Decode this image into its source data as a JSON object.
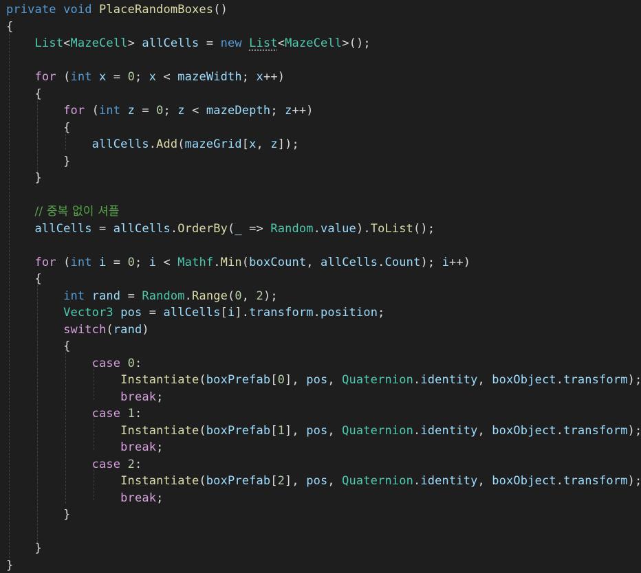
{
  "colors": {
    "background": "#1e1e1e",
    "keyword": "#569cd6",
    "control": "#d8a0df",
    "type": "#4ec9b0",
    "method": "#dcdcaa",
    "variable": "#9cdcfe",
    "plain": "#dcdcdc",
    "number": "#b5cea8",
    "comment": "#57a64a"
  },
  "lines": [
    [
      [
        "kw",
        "private"
      ],
      [
        "p",
        " "
      ],
      [
        "kw",
        "void"
      ],
      [
        "p",
        " "
      ],
      [
        "m",
        "PlaceRandomBoxes"
      ],
      [
        "p",
        "()"
      ]
    ],
    [
      [
        "p",
        "{"
      ]
    ],
    [
      [
        "p",
        "    "
      ],
      [
        "t",
        "List"
      ],
      [
        "p",
        "<"
      ],
      [
        "t",
        "MazeCell"
      ],
      [
        "p",
        "> "
      ],
      [
        "v",
        "allCells"
      ],
      [
        "p",
        " = "
      ],
      [
        "kw",
        "new"
      ],
      [
        "p",
        " "
      ],
      [
        "tsq",
        "List"
      ],
      [
        "p",
        "<"
      ],
      [
        "t",
        "MazeCell"
      ],
      [
        "p",
        ">();"
      ]
    ],
    [],
    [
      [
        "p",
        "    "
      ],
      [
        "c",
        "for"
      ],
      [
        "p",
        " ("
      ],
      [
        "kw",
        "int"
      ],
      [
        "p",
        " "
      ],
      [
        "v",
        "x"
      ],
      [
        "p",
        " = "
      ],
      [
        "n",
        "0"
      ],
      [
        "p",
        "; "
      ],
      [
        "v",
        "x"
      ],
      [
        "p",
        " < "
      ],
      [
        "v",
        "mazeWidth"
      ],
      [
        "p",
        "; "
      ],
      [
        "v",
        "x"
      ],
      [
        "p",
        "++)"
      ]
    ],
    [
      [
        "p",
        "    {"
      ]
    ],
    [
      [
        "p",
        "        "
      ],
      [
        "c",
        "for"
      ],
      [
        "p",
        " ("
      ],
      [
        "kw",
        "int"
      ],
      [
        "p",
        " "
      ],
      [
        "v",
        "z"
      ],
      [
        "p",
        " = "
      ],
      [
        "n",
        "0"
      ],
      [
        "p",
        "; "
      ],
      [
        "v",
        "z"
      ],
      [
        "p",
        " < "
      ],
      [
        "v",
        "mazeDepth"
      ],
      [
        "p",
        "; "
      ],
      [
        "v",
        "z"
      ],
      [
        "p",
        "++)"
      ]
    ],
    [
      [
        "p",
        "        {"
      ]
    ],
    [
      [
        "p",
        "            "
      ],
      [
        "v",
        "allCells"
      ],
      [
        "p",
        "."
      ],
      [
        "m",
        "Add"
      ],
      [
        "p",
        "("
      ],
      [
        "v",
        "mazeGrid"
      ],
      [
        "p",
        "["
      ],
      [
        "v",
        "x"
      ],
      [
        "p",
        ", "
      ],
      [
        "v",
        "z"
      ],
      [
        "p",
        "]);"
      ]
    ],
    [
      [
        "p",
        "        }"
      ]
    ],
    [
      [
        "p",
        "    }"
      ]
    ],
    [],
    [
      [
        "p",
        "    "
      ],
      [
        "cm",
        "// 중복 없이 셔플"
      ]
    ],
    [
      [
        "p",
        "    "
      ],
      [
        "v",
        "allCells"
      ],
      [
        "p",
        " = "
      ],
      [
        "v",
        "allCells"
      ],
      [
        "p",
        "."
      ],
      [
        "m",
        "OrderBy"
      ],
      [
        "p",
        "("
      ],
      [
        "v",
        "_"
      ],
      [
        "p",
        " => "
      ],
      [
        "t",
        "Random"
      ],
      [
        "p",
        "."
      ],
      [
        "v",
        "value"
      ],
      [
        "p",
        ")."
      ],
      [
        "m",
        "ToList"
      ],
      [
        "p",
        "();"
      ]
    ],
    [],
    [
      [
        "p",
        "    "
      ],
      [
        "c",
        "for"
      ],
      [
        "p",
        " ("
      ],
      [
        "kw",
        "int"
      ],
      [
        "p",
        " "
      ],
      [
        "v",
        "i"
      ],
      [
        "p",
        " = "
      ],
      [
        "n",
        "0"
      ],
      [
        "p",
        "; "
      ],
      [
        "v",
        "i"
      ],
      [
        "p",
        " < "
      ],
      [
        "t",
        "Mathf"
      ],
      [
        "p",
        "."
      ],
      [
        "m",
        "Min"
      ],
      [
        "p",
        "("
      ],
      [
        "v",
        "boxCount"
      ],
      [
        "p",
        ", "
      ],
      [
        "v",
        "allCells"
      ],
      [
        "p",
        "."
      ],
      [
        "v",
        "Count"
      ],
      [
        "p",
        "); "
      ],
      [
        "v",
        "i"
      ],
      [
        "p",
        "++)"
      ]
    ],
    [
      [
        "p",
        "    {"
      ]
    ],
    [
      [
        "p",
        "        "
      ],
      [
        "kw",
        "int"
      ],
      [
        "p",
        " "
      ],
      [
        "v",
        "rand"
      ],
      [
        "p",
        " = "
      ],
      [
        "t",
        "Random"
      ],
      [
        "p",
        "."
      ],
      [
        "m",
        "Range"
      ],
      [
        "p",
        "("
      ],
      [
        "n",
        "0"
      ],
      [
        "p",
        ", "
      ],
      [
        "n",
        "2"
      ],
      [
        "p",
        ");"
      ]
    ],
    [
      [
        "p",
        "        "
      ],
      [
        "t",
        "Vector3"
      ],
      [
        "p",
        " "
      ],
      [
        "v",
        "pos"
      ],
      [
        "p",
        " = "
      ],
      [
        "v",
        "allCells"
      ],
      [
        "p",
        "["
      ],
      [
        "v",
        "i"
      ],
      [
        "p",
        "]."
      ],
      [
        "v",
        "transform"
      ],
      [
        "p",
        "."
      ],
      [
        "v",
        "position"
      ],
      [
        "p",
        ";"
      ]
    ],
    [
      [
        "p",
        "        "
      ],
      [
        "c",
        "switch"
      ],
      [
        "p",
        "("
      ],
      [
        "v",
        "rand"
      ],
      [
        "p",
        ")"
      ]
    ],
    [
      [
        "p",
        "        {"
      ]
    ],
    [
      [
        "p",
        "            "
      ],
      [
        "c",
        "case"
      ],
      [
        "p",
        " "
      ],
      [
        "n",
        "0"
      ],
      [
        "p",
        ":"
      ]
    ],
    [
      [
        "p",
        "                "
      ],
      [
        "m",
        "Instantiate"
      ],
      [
        "p",
        "("
      ],
      [
        "v",
        "boxPrefab"
      ],
      [
        "p",
        "["
      ],
      [
        "n",
        "0"
      ],
      [
        "p",
        "], "
      ],
      [
        "v",
        "pos"
      ],
      [
        "p",
        ", "
      ],
      [
        "t",
        "Quaternion"
      ],
      [
        "p",
        "."
      ],
      [
        "v",
        "identity"
      ],
      [
        "p",
        ", "
      ],
      [
        "v",
        "boxObject"
      ],
      [
        "p",
        "."
      ],
      [
        "v",
        "transform"
      ],
      [
        "p",
        ");"
      ]
    ],
    [
      [
        "p",
        "                "
      ],
      [
        "c",
        "break"
      ],
      [
        "p",
        ";"
      ]
    ],
    [
      [
        "p",
        "            "
      ],
      [
        "c",
        "case"
      ],
      [
        "p",
        " "
      ],
      [
        "n",
        "1"
      ],
      [
        "p",
        ":"
      ]
    ],
    [
      [
        "p",
        "                "
      ],
      [
        "m",
        "Instantiate"
      ],
      [
        "p",
        "("
      ],
      [
        "v",
        "boxPrefab"
      ],
      [
        "p",
        "["
      ],
      [
        "n",
        "1"
      ],
      [
        "p",
        "], "
      ],
      [
        "v",
        "pos"
      ],
      [
        "p",
        ", "
      ],
      [
        "t",
        "Quaternion"
      ],
      [
        "p",
        "."
      ],
      [
        "v",
        "identity"
      ],
      [
        "p",
        ", "
      ],
      [
        "v",
        "boxObject"
      ],
      [
        "p",
        "."
      ],
      [
        "v",
        "transform"
      ],
      [
        "p",
        ");"
      ]
    ],
    [
      [
        "p",
        "                "
      ],
      [
        "c",
        "break"
      ],
      [
        "p",
        ";"
      ]
    ],
    [
      [
        "p",
        "            "
      ],
      [
        "c",
        "case"
      ],
      [
        "p",
        " "
      ],
      [
        "n",
        "2"
      ],
      [
        "p",
        ":"
      ]
    ],
    [
      [
        "p",
        "                "
      ],
      [
        "m",
        "Instantiate"
      ],
      [
        "p",
        "("
      ],
      [
        "v",
        "boxPrefab"
      ],
      [
        "p",
        "["
      ],
      [
        "n",
        "2"
      ],
      [
        "p",
        "], "
      ],
      [
        "v",
        "pos"
      ],
      [
        "p",
        ", "
      ],
      [
        "t",
        "Quaternion"
      ],
      [
        "p",
        "."
      ],
      [
        "v",
        "identity"
      ],
      [
        "p",
        ", "
      ],
      [
        "v",
        "boxObject"
      ],
      [
        "p",
        "."
      ],
      [
        "v",
        "transform"
      ],
      [
        "p",
        ");"
      ]
    ],
    [
      [
        "p",
        "                "
      ],
      [
        "c",
        "break"
      ],
      [
        "p",
        ";"
      ]
    ],
    [
      [
        "p",
        "        }"
      ]
    ],
    [],
    [
      [
        "p",
        "    }"
      ]
    ],
    [
      [
        "p",
        "}"
      ]
    ]
  ]
}
